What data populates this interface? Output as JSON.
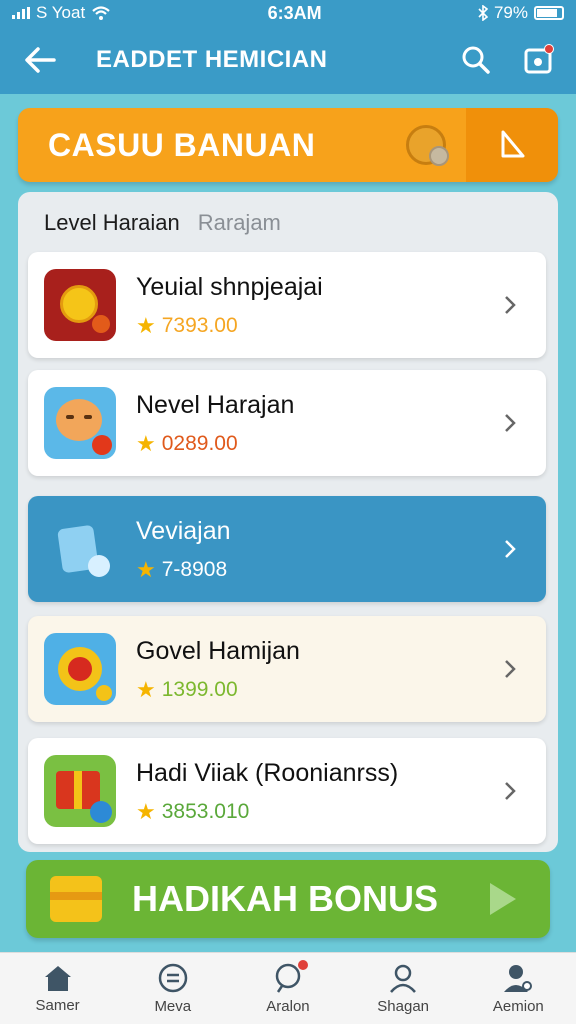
{
  "status_bar": {
    "carrier": "S Yoat",
    "time": "6:3AM",
    "battery": "79%"
  },
  "header": {
    "title": "EADDET HEMICIAN",
    "back_icon": "arrow-left-icon",
    "search_icon": "search-icon",
    "notification_icon": "notification-icon"
  },
  "banner": {
    "title": "CASUU BANUAN"
  },
  "tabs": [
    {
      "label": "Level Haraian",
      "active": true
    },
    {
      "label": "Rarajam",
      "active": false
    }
  ],
  "items": [
    {
      "title": "Yeuial shnpjeajai",
      "score": "7393.00",
      "score_color": "#f5a623"
    },
    {
      "title": "Nevel Harajan",
      "score": "0289.00",
      "score_color": "#e05a1c"
    },
    {
      "title": "Veviajan",
      "score": "7-8908",
      "score_color": "#ffffff"
    },
    {
      "title": "Govel Hamijan",
      "score": "1399.00",
      "score_color": "#7cb82f"
    },
    {
      "title": "Hadi Viiak (Roonianrss)",
      "score": "3853.010",
      "score_color": "#5aa83a"
    }
  ],
  "bonus": {
    "title": "HADIKAH BONUS"
  },
  "bottom_nav": [
    {
      "label": "Samer",
      "icon": "home-icon"
    },
    {
      "label": "Meva",
      "icon": "menu-circle-icon"
    },
    {
      "label": "Aralon",
      "icon": "chat-icon"
    },
    {
      "label": "Shagan",
      "icon": "profile-icon"
    },
    {
      "label": "Aemion",
      "icon": "user-settings-icon"
    }
  ],
  "colors": {
    "header": "#3a9bc7",
    "banner": "#f7a21b",
    "highlight_card": "#3a95c4",
    "bonus": "#6bb535",
    "background": "#6cc9d8"
  }
}
